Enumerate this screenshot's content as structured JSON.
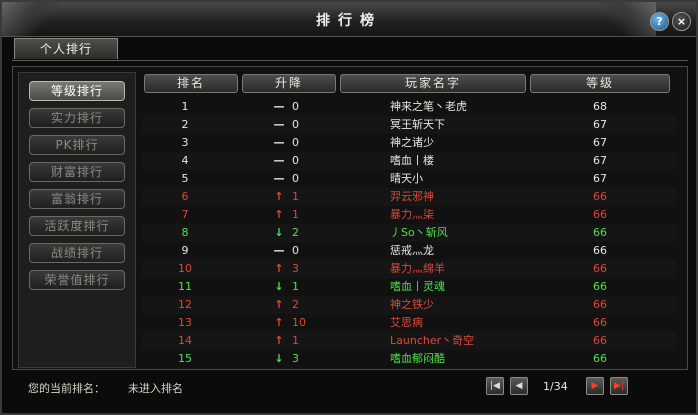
{
  "window": {
    "title": "排行榜"
  },
  "titlebar": {
    "help_label": "?",
    "close_label": "×"
  },
  "tabs": [
    {
      "label": "个人排行"
    }
  ],
  "sidebar": {
    "items": [
      {
        "label": "等级排行",
        "active": true
      },
      {
        "label": "实力排行",
        "active": false
      },
      {
        "label": "PK排行",
        "active": false
      },
      {
        "label": "财富排行",
        "active": false
      },
      {
        "label": "富翁排行",
        "active": false
      },
      {
        "label": "活跃度排行",
        "active": false
      },
      {
        "label": "战绩排行",
        "active": false
      },
      {
        "label": "荣誉值排行",
        "active": false
      }
    ]
  },
  "table": {
    "columns": [
      "排名",
      "升降",
      "玩家名字",
      "等级"
    ],
    "rows": [
      {
        "rank": "1",
        "arrow": "—",
        "change": "0",
        "name": "神来之笔丶老虎",
        "level": "68",
        "status": "same"
      },
      {
        "rank": "2",
        "arrow": "—",
        "change": "0",
        "name": "冥王斩天下",
        "level": "67",
        "status": "same"
      },
      {
        "rank": "3",
        "arrow": "—",
        "change": "0",
        "name": "神之诸少",
        "level": "67",
        "status": "same"
      },
      {
        "rank": "4",
        "arrow": "—",
        "change": "0",
        "name": "嗜血丨楼",
        "level": "67",
        "status": "same"
      },
      {
        "rank": "5",
        "arrow": "—",
        "change": "0",
        "name": "晴天小",
        "level": "67",
        "status": "same"
      },
      {
        "rank": "6",
        "arrow": "↑",
        "change": "1",
        "name": "羿云邪神",
        "level": "66",
        "status": "up"
      },
      {
        "rank": "7",
        "arrow": "↑",
        "change": "1",
        "name": "暴力灬柒",
        "level": "66",
        "status": "up"
      },
      {
        "rank": "8",
        "arrow": "↓",
        "change": "2",
        "name": "丿So丶斩风",
        "level": "66",
        "status": "down"
      },
      {
        "rank": "9",
        "arrow": "—",
        "change": "0",
        "name": "惩戒灬龙",
        "level": "66",
        "status": "same"
      },
      {
        "rank": "10",
        "arrow": "↑",
        "change": "3",
        "name": "暴力灬绵羊",
        "level": "66",
        "status": "up"
      },
      {
        "rank": "11",
        "arrow": "↓",
        "change": "1",
        "name": "嗜血丨灵魂",
        "level": "66",
        "status": "down"
      },
      {
        "rank": "12",
        "arrow": "↑",
        "change": "2",
        "name": "神之铁少",
        "level": "66",
        "status": "up"
      },
      {
        "rank": "13",
        "arrow": "↑",
        "change": "10",
        "name": "艾思病",
        "level": "66",
        "status": "up"
      },
      {
        "rank": "14",
        "arrow": "↑",
        "change": "1",
        "name": "Launcher丶奇空",
        "level": "66",
        "status": "up"
      },
      {
        "rank": "15",
        "arrow": "↓",
        "change": "3",
        "name": "嗜血郁闷酷",
        "level": "66",
        "status": "down"
      }
    ]
  },
  "footer": {
    "current_rank_label": "您的当前排名：",
    "current_rank_value": "未进入排名",
    "page_indicator": "1/34"
  },
  "colors": {
    "same": "#e8e6de",
    "up": "#e0463a",
    "down": "#4fe04a",
    "accent": "#ff3a2a"
  }
}
